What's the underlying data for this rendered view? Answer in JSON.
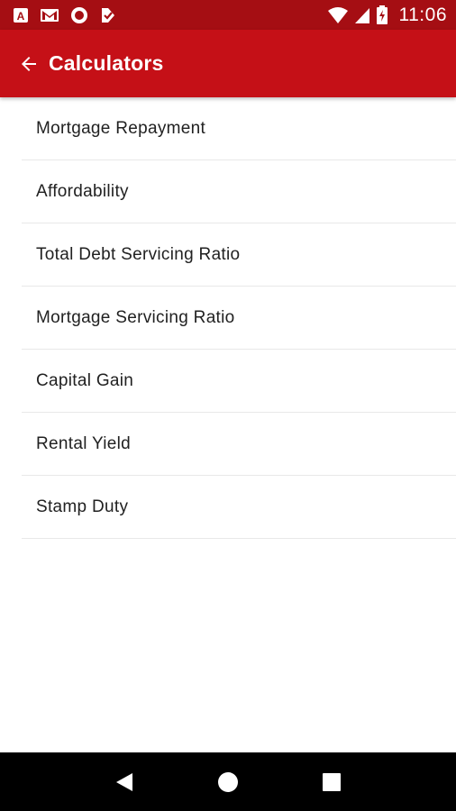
{
  "status_bar": {
    "time": "11:06",
    "left_icons": [
      "app-a-icon",
      "gmail-icon",
      "record-icon",
      "inbox-check-icon"
    ],
    "right_icons": [
      "wifi-icon",
      "cellular-signal-icon",
      "battery-charging-icon"
    ]
  },
  "app_bar": {
    "title": "Calculators",
    "back_icon": "arrow-back-icon",
    "color": "#c51017"
  },
  "calculators": {
    "items": [
      {
        "label": "Mortgage Repayment"
      },
      {
        "label": "Affordability"
      },
      {
        "label": "Total Debt Servicing Ratio"
      },
      {
        "label": "Mortgage Servicing Ratio"
      },
      {
        "label": "Capital Gain"
      },
      {
        "label": "Rental Yield"
      },
      {
        "label": "Stamp Duty"
      }
    ]
  },
  "nav_bar": {
    "buttons": [
      "back-triangle-icon",
      "home-circle-icon",
      "recents-square-icon"
    ]
  }
}
